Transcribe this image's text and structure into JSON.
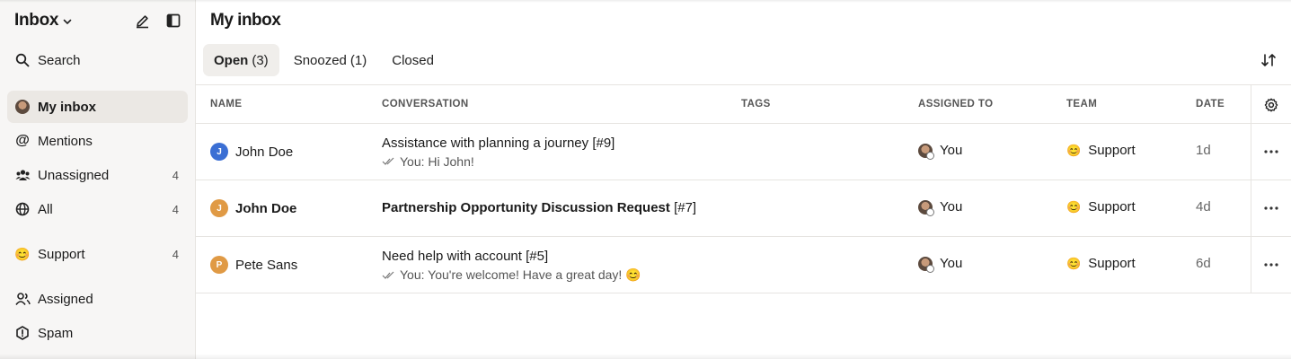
{
  "sidebar": {
    "title": "Inbox",
    "items": [
      {
        "label": "Search",
        "icon": "search-icon"
      },
      {
        "label": "My inbox",
        "icon": "user-avatar-icon",
        "active": true
      },
      {
        "label": "Mentions",
        "icon": "at-icon"
      },
      {
        "label": "Unassigned",
        "icon": "people-group-icon",
        "count": "4"
      },
      {
        "label": "All",
        "icon": "globe-icon",
        "count": "4"
      },
      {
        "label": "Support",
        "icon": "smile-emoji-icon",
        "count": "4"
      },
      {
        "label": "Assigned",
        "icon": "users-icon"
      },
      {
        "label": "Spam",
        "icon": "warning-hexagon-icon"
      }
    ]
  },
  "main": {
    "title": "My inbox",
    "tabs": [
      {
        "label": "Open",
        "count": "(3)"
      },
      {
        "label": "Snoozed",
        "count": "(1)"
      },
      {
        "label": "Closed",
        "count": ""
      }
    ],
    "columns": [
      "NAME",
      "CONVERSATION",
      "TAGS",
      "ASSIGNED TO",
      "TEAM",
      "DATE"
    ],
    "rows": [
      {
        "initial": "J",
        "avatar_color": "#3b6fd4",
        "name": "John Doe",
        "subject": "Assistance with planning a journey",
        "ref": "[#9]",
        "preview": "You: Hi John!",
        "assigned": "You",
        "team": "Support",
        "date": "1d"
      },
      {
        "initial": "J",
        "avatar_color": "#e09a45",
        "name": "John Doe",
        "subject": "Partnership Opportunity Discussion Request",
        "ref": "[#7]",
        "preview": "",
        "assigned": "You",
        "team": "Support",
        "date": "4d"
      },
      {
        "initial": "P",
        "avatar_color": "#e09a45",
        "name": "Pete Sans",
        "subject": "Need help with account",
        "ref": "[#5]",
        "preview": "You: You're welcome! Have a great day! 😊",
        "assigned": "You",
        "team": "Support",
        "date": "6d"
      }
    ],
    "team_emoji": "😊"
  }
}
